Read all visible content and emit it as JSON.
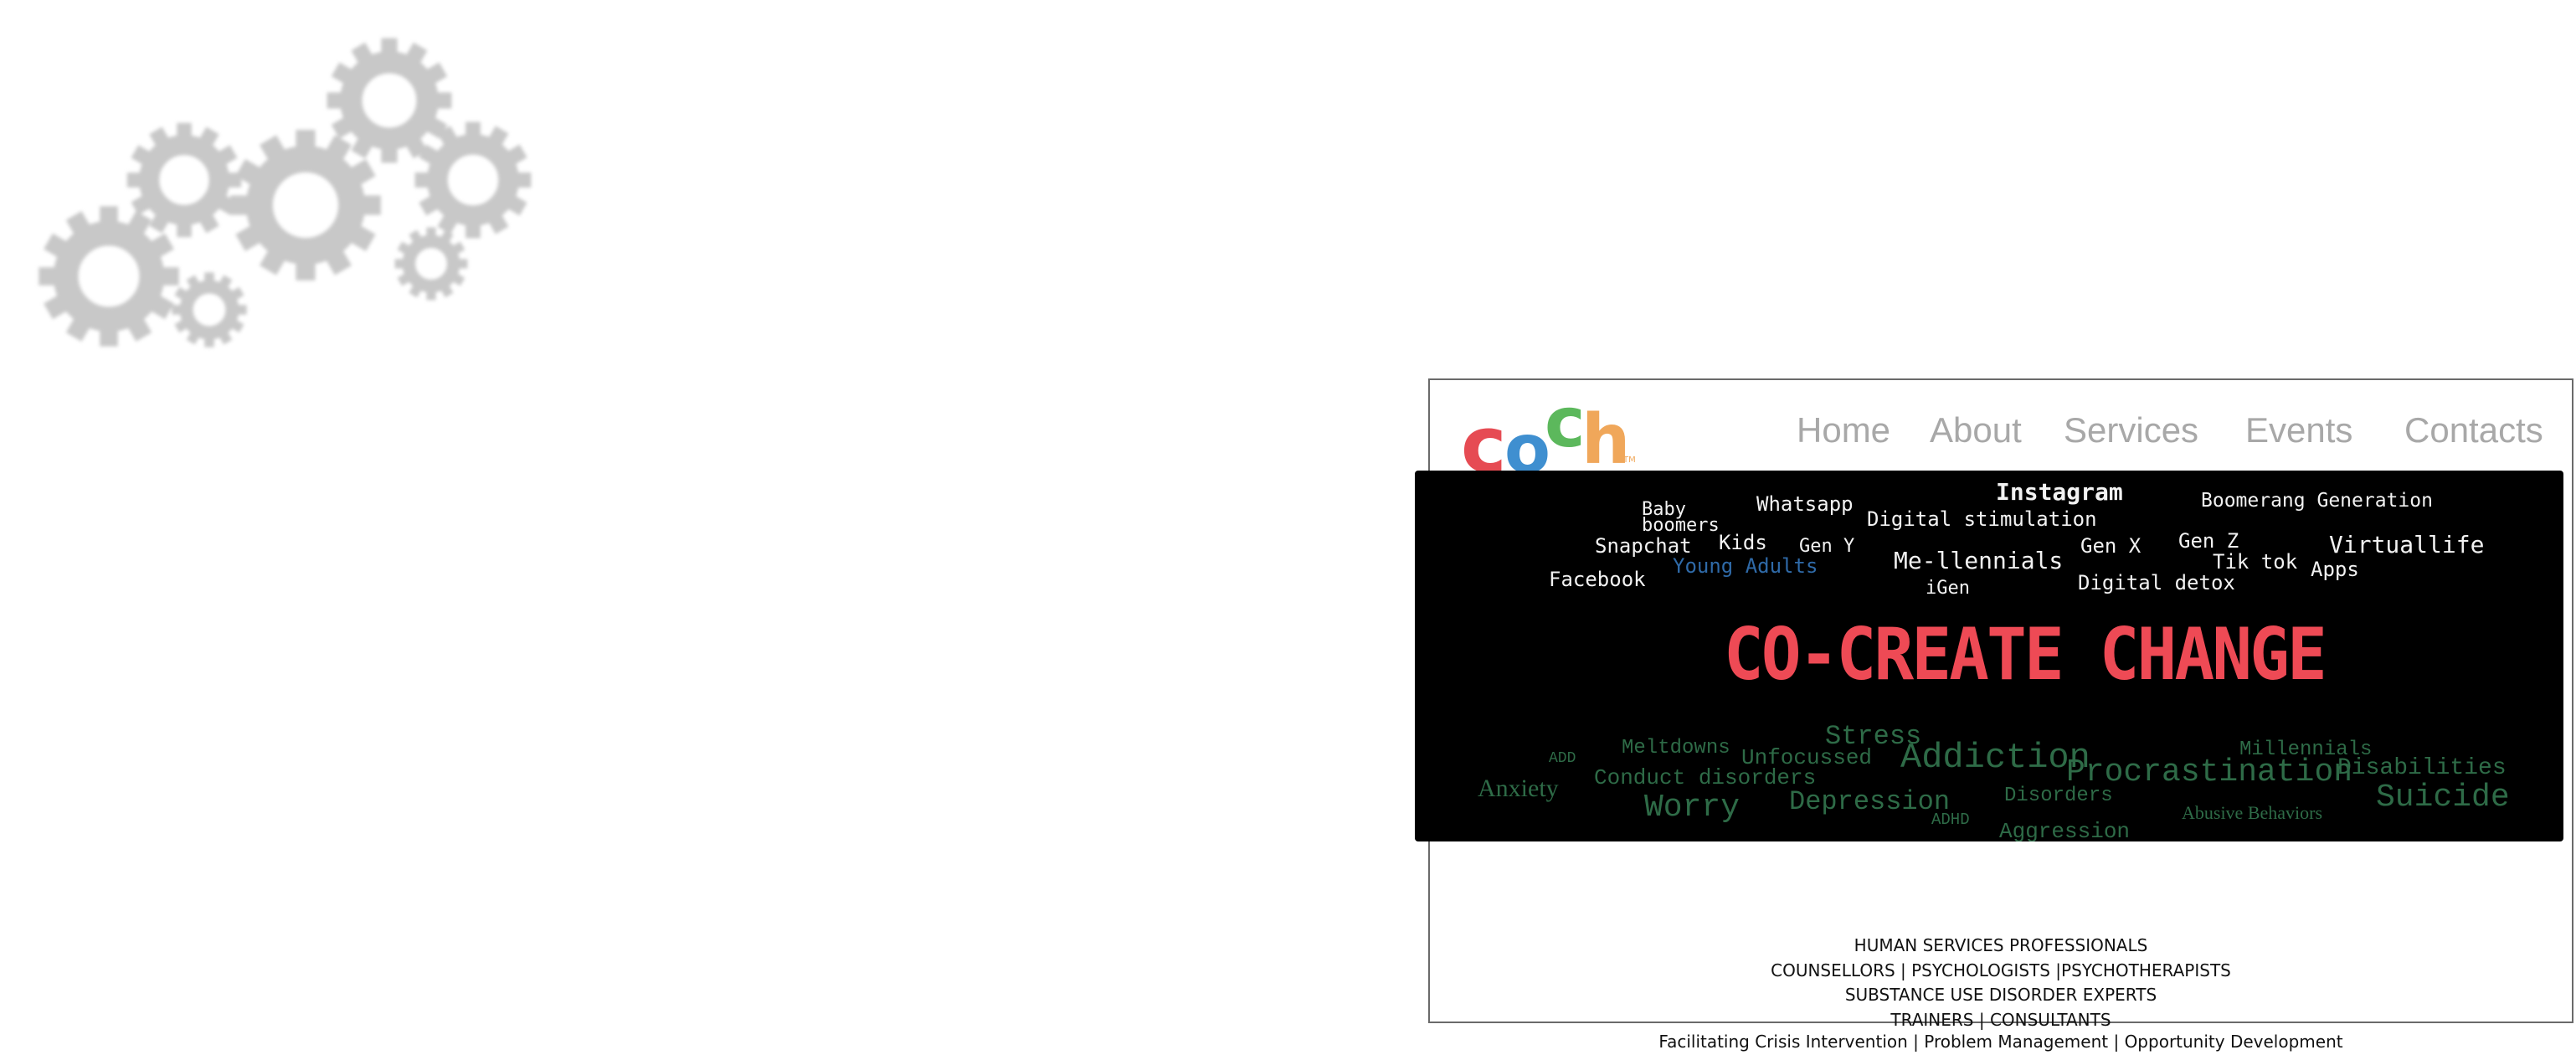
{
  "brand": {
    "logo_letters": [
      "c",
      "o",
      "c",
      "h"
    ],
    "logo_tm": "TM",
    "logo_colors": [
      "#e64b53",
      "#3f8fd0",
      "#5cb85c",
      "#f0a75a"
    ]
  },
  "nav": {
    "items": [
      {
        "label": "Home"
      },
      {
        "label": "About"
      },
      {
        "label": "Services"
      },
      {
        "label": "Events"
      },
      {
        "label": "Contacts"
      }
    ]
  },
  "banner": {
    "headline": "CO-CREATE CHANGE",
    "headline_color": "#ee4a55",
    "top_words": [
      "Baby",
      "boomers",
      "Whatsapp",
      "Instagram",
      "Boomerang Generation",
      "Digital stimulation",
      "Snapchat",
      "Kids",
      "Gen Y",
      "Gen X",
      "Gen Z",
      "Virtuallife",
      "Young Adults",
      "Me-llennials",
      "Tik tok",
      "Apps",
      "Facebook",
      "iGen",
      "Digital detox"
    ],
    "bottom_words": [
      "Stress",
      "ADD",
      "Meltdowns",
      "Unfocussed",
      "Addiction",
      "Millennials",
      "Anxiety",
      "Conduct disorders",
      "Procrastination",
      "Disabilities",
      "Disorders",
      "Worry",
      "Depression",
      "Suicide",
      "ADHD",
      "Abusive Behaviors",
      "Aggression"
    ]
  },
  "credits": {
    "lines": [
      "HUMAN SERVICES PROFESSIONALS",
      "COUNSELLORS | PSYCHOLOGISTS |PSYCHOTHERAPISTS",
      "SUBSTANCE USE DISORDER EXPERTS",
      "TRAINERS | CONSULTANTS"
    ],
    "tagline": "Facilitating Crisis Intervention | Problem Management | Opportunity Development"
  }
}
